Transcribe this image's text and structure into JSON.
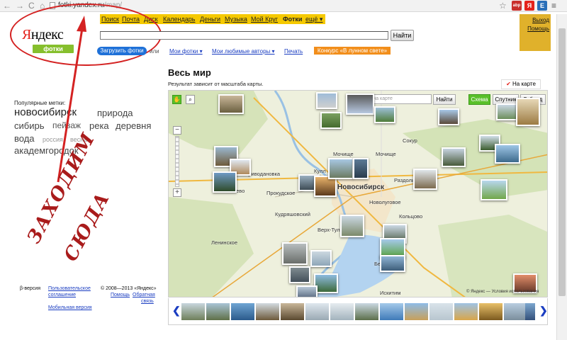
{
  "browser": {
    "url_host": "fotki.yandex.ru",
    "url_path": "/map/",
    "nav_back": "←",
    "nav_fwd": "→",
    "nav_reload": "C",
    "nav_home": "⌂",
    "star": "☆",
    "ext_icons": [
      "abp",
      "Я",
      "E"
    ],
    "menu": "≡"
  },
  "services": {
    "items": [
      "Поиск",
      "Почта",
      "Диск",
      "Календарь",
      "Деньги",
      "Музыка",
      "Мой Круг",
      "Фотки",
      "ещё ▾"
    ],
    "current": "Фотки",
    "user_links": [
      "Выход",
      "Помощь"
    ]
  },
  "logo": {
    "ya_first": "Я",
    "ya_rest": "ндекс",
    "sub": "фотки"
  },
  "search": {
    "button": "Найти",
    "value": ""
  },
  "subnav": {
    "upload": "Загрузить фотки",
    "or": "или",
    "my_photos": "Мои фотки ▾",
    "fav_authors": "Мои любимые авторы ▾",
    "print": "Печать",
    "contest": "Конкурс «В лунном свете»"
  },
  "tags": {
    "heading": "Популярные метки:",
    "items": [
      {
        "text": "новосибирск",
        "size": 15
      },
      {
        "text": "природа",
        "size": 13
      },
      {
        "text": "сибирь",
        "size": 13
      },
      {
        "text": "пейзаж",
        "size": 12
      },
      {
        "text": "река",
        "size": 13
      },
      {
        "text": "деревня",
        "size": 13
      },
      {
        "text": "вода",
        "size": 13
      },
      {
        "text": "россия",
        "size": 9
      },
      {
        "text": "весна",
        "size": 9
      },
      {
        "text": "академгородок",
        "size": 13
      }
    ]
  },
  "footer": {
    "beta": "β-версия",
    "agreement1": "Пользовательское",
    "agreement2": "соглашение",
    "mobile": "Мобильная версия",
    "copyright": "© 2008—2013 «Яндекс»",
    "help": "Помощь",
    "feedback1": "Обратная",
    "feedback2": "связь"
  },
  "overlay": {
    "line1": "ЗАХОДИМ",
    "line2": "СЮДА",
    "color": "#a91b1b"
  },
  "map": {
    "title": "Весь мир",
    "subtitle": "Результат зависит от масштаба карты.",
    "on_map": "На карте",
    "search_placeholder": "Поиск на карте",
    "find": "Найти",
    "types": [
      "Схема",
      "Спутник",
      "Гибрид"
    ],
    "active_type": "Схема",
    "copyright": "© Яндекс — Условия использования",
    "places": [
      "Новосибирск",
      "Мочище",
      "Мочище",
      "Сокур",
      "Раздольное",
      "Новолуговое",
      "Кольцово",
      "Верх-Тула",
      "Прокудское",
      "Криводановка",
      "Кудряшовский",
      "Искитим",
      "Берёзовка",
      "ево",
      "Кулл",
      "Ленинское"
    ]
  }
}
